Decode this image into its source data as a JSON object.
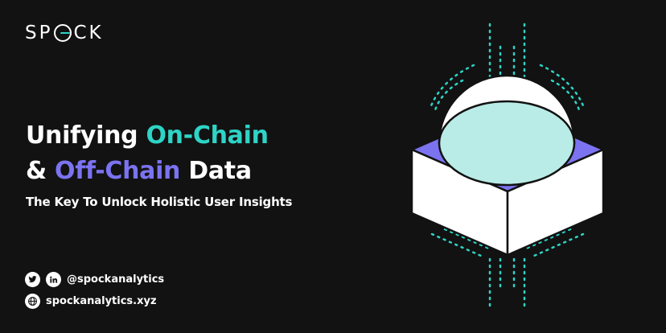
{
  "logo": {
    "text_left": "SP",
    "text_right": "CK"
  },
  "headline": {
    "line1_plain": "Unifying ",
    "line1_accent": "On-Chain",
    "line2_plain_start": "& ",
    "line2_accent": "Off-Chain",
    "line2_plain_end": " Data"
  },
  "subheadline": "The Key To Unlock Holistic User Insights",
  "social": {
    "handle": "@spockanalytics",
    "website": "spockanalytics.xyz",
    "icons": [
      "twitter-icon",
      "linkedin-icon",
      "globe-icon"
    ]
  },
  "colors": {
    "background": "#121212",
    "teal": "#2ed4c6",
    "purple": "#7b73f0",
    "dome_fill": "#b9ece6"
  }
}
